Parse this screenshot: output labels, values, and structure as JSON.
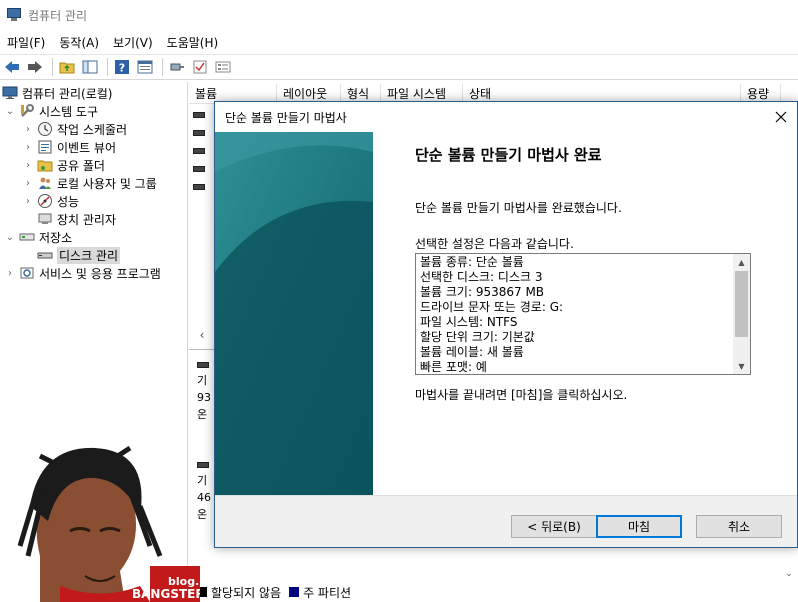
{
  "window": {
    "title": "컴퓨터 관리"
  },
  "menu": [
    "파일(F)",
    "동작(A)",
    "보기(V)",
    "도움말(H)"
  ],
  "tree": {
    "root": "컴퓨터 관리(로컬)",
    "system_tools": "시스템 도구",
    "task_scheduler": "작업 스케줄러",
    "event_viewer": "이벤트 뷰어",
    "shared_folders": "공유 폴더",
    "local_users": "로컬 사용자 및 그룹",
    "performance": "성능",
    "device_manager": "장치 관리자",
    "storage": "저장소",
    "disk_management": "디스크 관리",
    "services": "서비스 및 응용 프로그램"
  },
  "columns": [
    "볼륨",
    "레이아웃",
    "형식",
    "파일 시스템",
    "상태",
    "용량"
  ],
  "disk_labels": {
    "d1a": "기",
    "d1b": "93",
    "d1c": "온",
    "d2a": "기",
    "d2b": "46",
    "d2c": "온"
  },
  "legend": {
    "unallocated": "할당되지 않음",
    "primary": "주 파티션"
  },
  "colors": {
    "unallocated": "#000000",
    "primary": "#00007f",
    "accent": "#0078d7",
    "wizard_side": "#0c5a63"
  },
  "dialog": {
    "title": "단순 볼륨 만들기 마법사",
    "heading": "단순 볼륨 만들기 마법사 완료",
    "completed": "단순 볼륨 만들기 마법사를 완료했습니다.",
    "settings_intro": "선택한 설정은 다음과 같습니다.",
    "summary": [
      "볼륨 종류: 단순 볼륨",
      "선택한 디스크: 디스크 3",
      "볼륨 크기: 953867 MB",
      "드라이브 문자 또는 경로: G:",
      "파일 시스템: NTFS",
      "할당 단위 크기: 기본값",
      "볼륨 레이블: 새 볼륨",
      "빠른 포맷: 예"
    ],
    "finish_hint": "마법사를 끝내려면 [마침]을 클릭하십시오.",
    "back": "< 뒤로(B)",
    "finish": "마침",
    "cancel": "취소"
  },
  "watermark": {
    "top": "blog.",
    "bottom": "BANGSTER"
  }
}
